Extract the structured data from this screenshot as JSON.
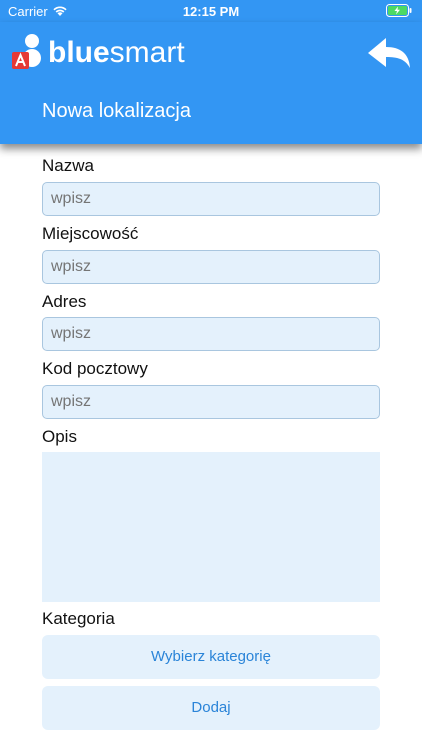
{
  "status_bar": {
    "carrier": "Carrier",
    "time": "12:15 PM"
  },
  "header": {
    "logo_bold": "blue",
    "logo_light": "smart",
    "title": "Nowa lokalizacja",
    "accent_color": "#3396f3"
  },
  "form": {
    "name": {
      "label": "Nazwa",
      "placeholder": "wpisz"
    },
    "city": {
      "label": "Miejscowość",
      "placeholder": "wpisz"
    },
    "address": {
      "label": "Adres",
      "placeholder": "wpisz"
    },
    "postal": {
      "label": "Kod pocztowy",
      "placeholder": "wpisz"
    },
    "description": {
      "label": "Opis"
    },
    "category": {
      "label": "Kategoria",
      "button": "Wybierz kategorię"
    },
    "submit": "Dodaj"
  }
}
